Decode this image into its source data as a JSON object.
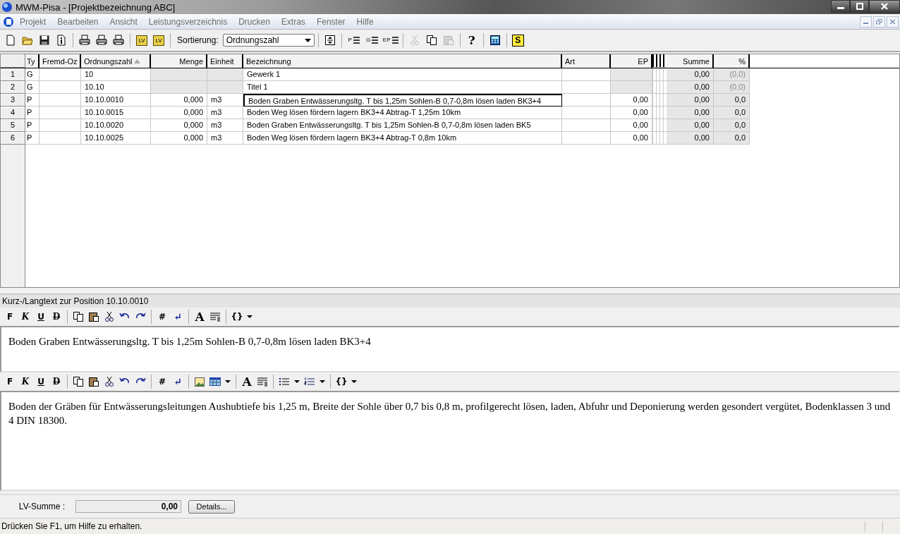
{
  "window": {
    "title": "MWM-Pisa - [Projektbezeichnung ABC]"
  },
  "menu": [
    "Projekt",
    "Bearbeiten",
    "Ansicht",
    "Leistungsverzeichnis",
    "Drucken",
    "Extras",
    "Fenster",
    "Hilfe"
  ],
  "toolbar": {
    "groups": [
      {
        "items": [
          {
            "kind": "new",
            "disabled": false
          },
          {
            "kind": "open",
            "disabled": false
          },
          {
            "kind": "save",
            "disabled": false
          },
          {
            "kind": "info",
            "disabled": false
          }
        ]
      },
      {
        "items": [
          {
            "kind": "print",
            "disabled": false
          },
          {
            "kind": "print",
            "disabled": false
          },
          {
            "kind": "print",
            "disabled": false
          }
        ]
      },
      {
        "items": [
          {
            "kind": "lvin",
            "disabled": false,
            "label": "LV"
          },
          {
            "kind": "lvout",
            "disabled": false,
            "label": "LV"
          }
        ]
      },
      {
        "items": [
          {
            "kind": "label",
            "disabled": false,
            "label": "Sortierung:"
          },
          {
            "kind": "select",
            "disabled": false,
            "label": "Ordnungszahl"
          }
        ]
      },
      {
        "items": [
          {
            "kind": "expand",
            "disabled": false
          }
        ]
      },
      {
        "items": [
          {
            "kind": "list",
            "disabled": false,
            "label": "P"
          },
          {
            "kind": "list",
            "disabled": false,
            "label": "G"
          },
          {
            "kind": "list",
            "disabled": false,
            "label": "EP"
          }
        ]
      },
      {
        "items": [
          {
            "kind": "cut",
            "disabled": true
          },
          {
            "kind": "copy",
            "disabled": false
          },
          {
            "kind": "paste",
            "disabled": true
          }
        ]
      },
      {
        "items": [
          {
            "kind": "glyph",
            "disabled": false,
            "label": "?"
          }
        ]
      },
      {
        "items": [
          {
            "kind": "calc",
            "disabled": false
          }
        ]
      },
      {
        "items": [
          {
            "kind": "logo",
            "disabled": false,
            "label": "S"
          }
        ]
      }
    ]
  },
  "grid": {
    "columns": [
      {
        "label": "Ty",
        "sorted": false
      },
      {
        "label": "Fremd-Oz",
        "sorted": false
      },
      {
        "label": "Ordnungszahl",
        "sorted": true
      },
      {
        "label": "Menge",
        "sorted": false
      },
      {
        "label": "Einheit",
        "sorted": false
      },
      {
        "label": "Bezeichnung",
        "sorted": false
      },
      {
        "label": "Art",
        "sorted": false
      },
      {
        "label": "EP",
        "sorted": false
      },
      {
        "label": "Summe",
        "sorted": false
      },
      {
        "label": "%",
        "sorted": false
      }
    ],
    "rows": [
      {
        "number": "1",
        "kind": "group",
        "selected": false,
        "cells": [
          "G",
          "",
          "10",
          "",
          "",
          "Gewerk 1",
          "",
          "",
          "0,00",
          "(0,0)"
        ]
      },
      {
        "number": "2",
        "kind": "group",
        "selected": false,
        "cells": [
          "G",
          "",
          "10.10",
          "",
          "",
          "Titel 1",
          "",
          "",
          "0,00",
          "(0,0)"
        ]
      },
      {
        "number": "3",
        "kind": "position",
        "selected": true,
        "cells": [
          "P",
          "",
          "10.10.0010",
          "0,000",
          "m3",
          "Boden Graben Entwässerungsltg. T bis 1,25m Sohlen-B 0,7-0,8m lösen laden BK3+4",
          "",
          "0,00",
          "0,00",
          "0,0"
        ]
      },
      {
        "number": "4",
        "kind": "position",
        "selected": false,
        "cells": [
          "P",
          "",
          "10.10.0015",
          "0,000",
          "m3",
          "Boden Weg lösen fördern lagern BK3+4 Abtrag-T 1,25m 10km",
          "",
          "0,00",
          "0,00",
          "0,0"
        ]
      },
      {
        "number": "5",
        "kind": "position",
        "selected": false,
        "cells": [
          "P",
          "",
          "10.10.0020",
          "0,000",
          "m3",
          "Boden Graben Entwässerungsltg. T bis 1,25m Sohlen-B 0,7-0,8m lösen laden BK5",
          "",
          "0,00",
          "0,00",
          "0,0"
        ]
      },
      {
        "number": "6",
        "kind": "position",
        "selected": false,
        "cells": [
          "P",
          "",
          "10.10.0025",
          "0,000",
          "m3",
          "Boden Weg lösen fördern lagern BK3+4 Abtrag-T 0,8m 10km",
          "",
          "0,00",
          "0,00",
          "0,0"
        ]
      }
    ]
  },
  "text_panel": {
    "title": "Kurz-/Langtext zur Position 10.10.0010",
    "short_toolbar": [
      {
        "items": [
          {
            "kind": "bold",
            "label": "F"
          },
          {
            "kind": "italic",
            "label": "K"
          },
          {
            "kind": "underline",
            "label": "U"
          },
          {
            "kind": "strike",
            "label": "D"
          }
        ]
      },
      {
        "items": [
          {
            "kind": "copy"
          },
          {
            "kind": "paste"
          },
          {
            "kind": "cut"
          },
          {
            "kind": "undo"
          },
          {
            "kind": "redo"
          }
        ]
      },
      {
        "items": [
          {
            "kind": "glyph",
            "label": "#"
          },
          {
            "kind": "return",
            "label": "↵"
          }
        ]
      },
      {
        "items": [
          {
            "kind": "font",
            "label": "A"
          },
          {
            "kind": "paragraph"
          }
        ]
      },
      {
        "items": [
          {
            "kind": "glyph",
            "label": "{}"
          },
          {
            "kind": "caret"
          }
        ]
      }
    ],
    "short_text": "Boden Graben Entwässerungsltg. T bis 1,25m Sohlen-B 0,7-0,8m lösen laden BK3+4",
    "long_toolbar": [
      {
        "items": [
          {
            "kind": "bold",
            "label": "F"
          },
          {
            "kind": "italic",
            "label": "K"
          },
          {
            "kind": "underline",
            "label": "U"
          },
          {
            "kind": "strike",
            "label": "D"
          }
        ]
      },
      {
        "items": [
          {
            "kind": "copy"
          },
          {
            "kind": "paste"
          },
          {
            "kind": "cut"
          },
          {
            "kind": "undo"
          },
          {
            "kind": "redo"
          }
        ]
      },
      {
        "items": [
          {
            "kind": "glyph",
            "label": "#"
          },
          {
            "kind": "return",
            "label": "↵"
          }
        ]
      },
      {
        "items": [
          {
            "kind": "image"
          },
          {
            "kind": "table"
          },
          {
            "kind": "caret"
          }
        ]
      },
      {
        "items": [
          {
            "kind": "font",
            "label": "A"
          },
          {
            "kind": "paragraph"
          }
        ]
      },
      {
        "items": [
          {
            "kind": "bullets"
          },
          {
            "kind": "caret"
          },
          {
            "kind": "numbers"
          },
          {
            "kind": "caret"
          }
        ]
      },
      {
        "items": [
          {
            "kind": "glyph",
            "label": "{}"
          },
          {
            "kind": "caret"
          }
        ]
      }
    ],
    "long_text": "Boden der Gräben für Entwässerungsleitungen Aushubtiefe bis 1,25 m, Breite der Sohle über 0,7 bis 0,8 m, profilgerecht lösen, laden, Abfuhr und Deponierung werden gesondert vergütet, Bodenklassen 3 und 4 DIN 18300."
  },
  "summary": {
    "label": "LV-Summe :",
    "value": "0,00",
    "button": "Details..."
  },
  "status_bar": "Drücken Sie F1, um Hilfe zu erhalten."
}
